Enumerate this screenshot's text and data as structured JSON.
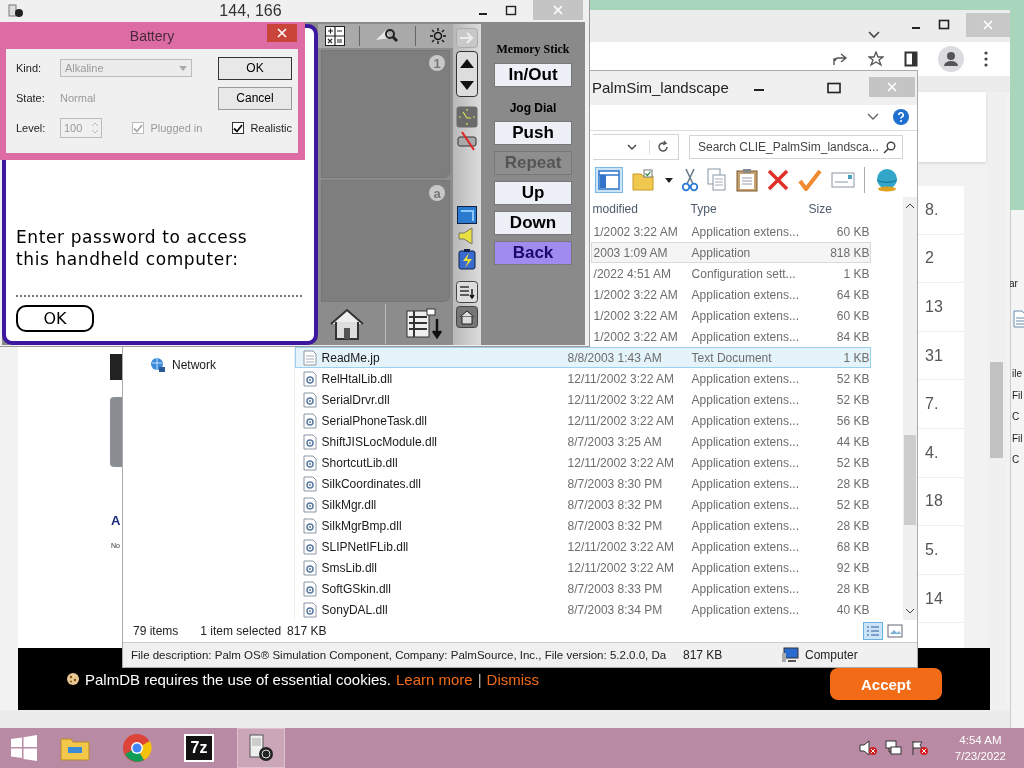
{
  "palm_window": {
    "title": "144, 166",
    "screen": {
      "prompt": "Enter password to access this handheld computer:",
      "ok": "OK"
    },
    "writing_area_marks": [
      "1",
      "a"
    ],
    "memory_stick_label": "Memory Stick",
    "memory_stick_button": "In/Out",
    "jog_dial_label": "Jog Dial",
    "jog_buttons": [
      {
        "label": "Push",
        "disabled": false,
        "selected": false
      },
      {
        "label": "Repeat",
        "disabled": true,
        "selected": false
      },
      {
        "label": "Up",
        "disabled": false,
        "selected": false
      },
      {
        "label": "Down",
        "disabled": false,
        "selected": false
      },
      {
        "label": "Back",
        "disabled": false,
        "selected": true
      }
    ]
  },
  "battery_dialog": {
    "title": "Battery",
    "kind": {
      "label": "Kind:",
      "value": "Alkaline",
      "disabled": true
    },
    "state": {
      "label": "State:",
      "value": "Normal"
    },
    "level": {
      "label": "Level:",
      "value": "100",
      "disabled": true
    },
    "ok": "OK",
    "cancel": "Cancel",
    "checkboxes": [
      {
        "label": "Plugged in",
        "checked": true,
        "disabled": true
      },
      {
        "label": "Realistic",
        "checked": true,
        "disabled": false
      }
    ]
  },
  "explorer": {
    "title": "PalmSim_landscape",
    "search": {
      "placeholder": "Search CLIE_PalmSim_landsca..."
    },
    "nav_items": [
      {
        "label": "Network"
      }
    ],
    "columns": [
      "modified",
      "Type",
      "Size"
    ],
    "rows": [
      {
        "date": "1/2002 3:22 AM",
        "type": "Application extens...",
        "size": "60 KB",
        "selected": false,
        "hovered": false
      },
      {
        "date": "2003 1:09 AM",
        "type": "Application",
        "size": "818 KB",
        "selected": false,
        "hovered": true
      },
      {
        "date": "/2022 4:51 AM",
        "type": "Configuration sett...",
        "size": "1 KB",
        "selected": false,
        "hovered": false
      },
      {
        "date": "1/2002 3:22 AM",
        "type": "Application extens...",
        "size": "64 KB",
        "selected": false,
        "hovered": false
      },
      {
        "date": "1/2002 3:22 AM",
        "type": "Application extens...",
        "size": "60 KB",
        "selected": false,
        "hovered": false
      },
      {
        "date": "1/2002 3:22 AM",
        "type": "Application extens...",
        "size": "84 KB",
        "selected": false,
        "hovered": false
      },
      {
        "kind": "text",
        "name": "ReadMe.jp",
        "date": "8/8/2003 1:43 AM",
        "type": "Text Document",
        "size": "1 KB",
        "selected": true,
        "hovered": false
      },
      {
        "kind": "dll",
        "name": "RelHtalLib.dll",
        "date": "12/11/2002 3:22 AM",
        "type": "Application extens...",
        "size": "52 KB",
        "selected": false,
        "hovered": false
      },
      {
        "kind": "dll",
        "name": "SerialDrvr.dll",
        "date": "12/11/2002 3:22 AM",
        "type": "Application extens...",
        "size": "52 KB",
        "selected": false,
        "hovered": false
      },
      {
        "kind": "dll",
        "name": "SerialPhoneTask.dll",
        "date": "12/11/2002 3:22 AM",
        "type": "Application extens...",
        "size": "56 KB",
        "selected": false,
        "hovered": false
      },
      {
        "kind": "dll",
        "name": "ShiftJISLocModule.dll",
        "date": "8/7/2003 3:25 AM",
        "type": "Application extens...",
        "size": "44 KB",
        "selected": false,
        "hovered": false
      },
      {
        "kind": "dll",
        "name": "ShortcutLib.dll",
        "date": "12/11/2002 3:22 AM",
        "type": "Application extens...",
        "size": "52 KB",
        "selected": false,
        "hovered": false
      },
      {
        "kind": "dll",
        "name": "SilkCoordinates.dll",
        "date": "8/7/2003 8:30 PM",
        "type": "Application extens...",
        "size": "28 KB",
        "selected": false,
        "hovered": false
      },
      {
        "kind": "dll",
        "name": "SilkMgr.dll",
        "date": "8/7/2003 8:32 PM",
        "type": "Application extens...",
        "size": "52 KB",
        "selected": false,
        "hovered": false
      },
      {
        "kind": "dll",
        "name": "SilkMgrBmp.dll",
        "date": "8/7/2003 8:32 PM",
        "type": "Application extens...",
        "size": "28 KB",
        "selected": false,
        "hovered": false
      },
      {
        "kind": "dll",
        "name": "SLIPNetIFLib.dll",
        "date": "12/11/2002 3:22 AM",
        "type": "Application extens...",
        "size": "68 KB",
        "selected": false,
        "hovered": false
      },
      {
        "kind": "dll",
        "name": "SmsLib.dll",
        "date": "12/11/2002 3:22 AM",
        "type": "Application extens...",
        "size": "92 KB",
        "selected": false,
        "hovered": false
      },
      {
        "kind": "dll",
        "name": "SoftGSkin.dll",
        "date": "8/7/2003 8:33 PM",
        "type": "Application extens...",
        "size": "28 KB",
        "selected": false,
        "hovered": false
      },
      {
        "kind": "dll",
        "name": "SonyDAL.dll",
        "date": "8/7/2003 8:34 PM",
        "type": "Application extens...",
        "size": "40 KB",
        "selected": false,
        "hovered": false
      }
    ],
    "status": {
      "count": "79 items",
      "selection": "1 item selected",
      "selection_size": "817 KB"
    },
    "details": {
      "description": "File description: Palm OS® Simulation Component, Company: PalmSource, Inc., File version: 5.2.0.0, Da",
      "size": "817 KB",
      "location": "Computer"
    }
  },
  "browser": {
    "column_values": [
      "8.",
      "2",
      "13",
      "31",
      "7.",
      "4.",
      "18",
      "5.",
      "14"
    ],
    "fragments": [
      "A",
      "No"
    ],
    "cookie_banner": {
      "text": "PalmDB requires the use of essential cookies.",
      "learn_more": "Learn more",
      "separator": "|",
      "dismiss": "Dismiss",
      "accept": "Accept"
    }
  },
  "right_window_fragments": [
    "ar",
    "ile",
    "Fil",
    "C",
    "Fil",
    "C"
  ],
  "taskbar": {
    "apps": [
      {
        "kind": "explorer",
        "active": false
      },
      {
        "kind": "chrome",
        "active": false
      },
      {
        "kind": "archiver",
        "label": "7z",
        "active": false
      },
      {
        "kind": "palm",
        "active": true
      }
    ],
    "time": "4:54 AM",
    "date": "7/23/2022"
  }
}
